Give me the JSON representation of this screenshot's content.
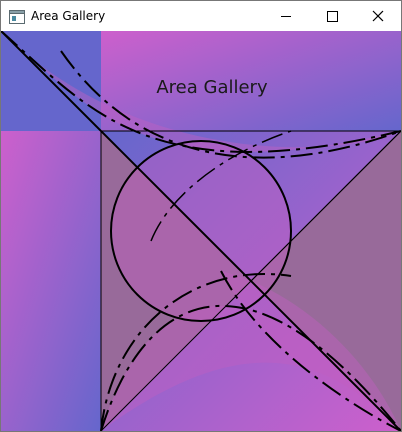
{
  "window": {
    "title": "Area Gallery",
    "icon": "app-window-icon",
    "controls": {
      "minimize_icon": "minimize-icon",
      "maximize_icon": "maximize-icon",
      "close_icon": "close-icon"
    }
  },
  "canvas": {
    "heading": "Area Gallery",
    "colors": {
      "blue": "#6566cc",
      "magenta": "#cd60cc",
      "mauve": "#986a9a",
      "fill_translucent": "#c060c0",
      "stroke": "#000000"
    }
  }
}
